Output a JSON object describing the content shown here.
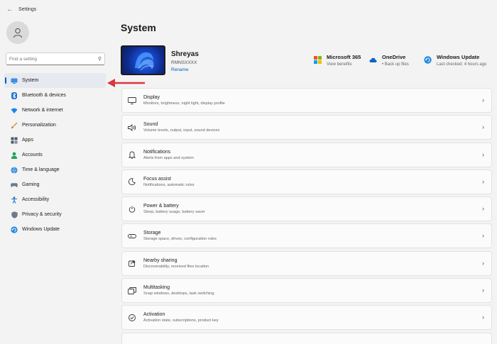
{
  "window": {
    "title": "Settings",
    "back_icon": "back-arrow-icon"
  },
  "sidebar": {
    "search_placeholder": "Find a setting",
    "items": [
      {
        "label": "System",
        "icon": "system-icon",
        "active": true
      },
      {
        "label": "Bluetooth & devices",
        "icon": "bluetooth-icon"
      },
      {
        "label": "Network & internet",
        "icon": "network-icon"
      },
      {
        "label": "Personalization",
        "icon": "brush-icon"
      },
      {
        "label": "Apps",
        "icon": "apps-icon"
      },
      {
        "label": "Accounts",
        "icon": "accounts-icon"
      },
      {
        "label": "Time & language",
        "icon": "globe-icon"
      },
      {
        "label": "Gaming",
        "icon": "gamepad-icon"
      },
      {
        "label": "Accessibility",
        "icon": "accessibility-icon"
      },
      {
        "label": "Privacy & security",
        "icon": "shield-icon"
      },
      {
        "label": "Windows Update",
        "icon": "update-icon"
      }
    ]
  },
  "header": {
    "title": "System"
  },
  "device": {
    "name": "Shreyas",
    "model": "RMNSXXXX",
    "rename_label": "Rename"
  },
  "quick_links": [
    {
      "title": "Microsoft 365",
      "subtitle": "View benefits",
      "icon": "microsoft-logo-icon"
    },
    {
      "title": "OneDrive",
      "subtitle": "• Back up files",
      "icon": "cloud-icon"
    },
    {
      "title": "Windows Update",
      "subtitle": "Last checked: 4 hours ago",
      "icon": "update-icon"
    }
  ],
  "settings": [
    {
      "title": "Display",
      "subtitle": "Monitors, brightness, night light, display profile",
      "icon": "display-icon"
    },
    {
      "title": "Sound",
      "subtitle": "Volume levels, output, input, sound devices",
      "icon": "speaker-icon"
    },
    {
      "title": "Notifications",
      "subtitle": "Alerts from apps and system",
      "icon": "bell-icon"
    },
    {
      "title": "Focus assist",
      "subtitle": "Notifications, automatic rules",
      "icon": "moon-icon"
    },
    {
      "title": "Power & battery",
      "subtitle": "Sleep, battery usage, battery saver",
      "icon": "power-icon"
    },
    {
      "title": "Storage",
      "subtitle": "Storage space, drives, configuration rules",
      "icon": "storage-icon"
    },
    {
      "title": "Nearby sharing",
      "subtitle": "Discoverability, received files location",
      "icon": "share-icon"
    },
    {
      "title": "Multitasking",
      "subtitle": "Snap windows, desktops, task switching",
      "icon": "multitasking-icon"
    },
    {
      "title": "Activation",
      "subtitle": "Activation state, subscriptions, product key",
      "icon": "activation-icon"
    }
  ],
  "colors": {
    "accent": "#005fb8",
    "annotation_arrow": "#d9363e",
    "background": "#f3f3f3"
  }
}
